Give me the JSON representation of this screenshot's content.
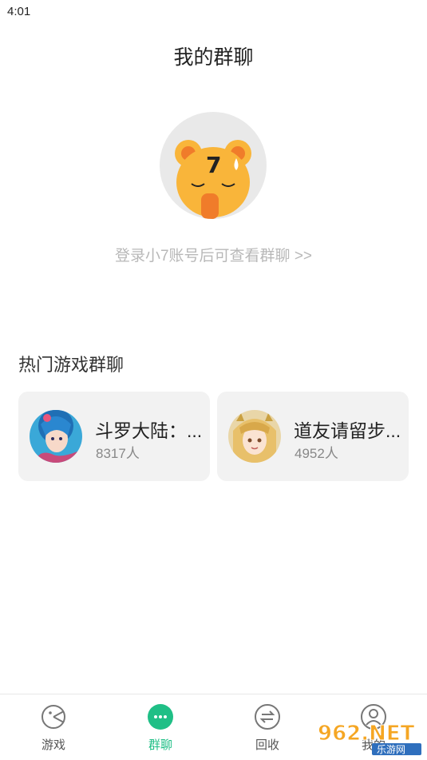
{
  "status_bar": {
    "time": "4:01"
  },
  "header": {
    "title": "我的群聊"
  },
  "login_prompt": {
    "text": "登录小7账号后可查看群聊 >>"
  },
  "hot_groups": {
    "title": "热门游戏群聊",
    "items": [
      {
        "name": "斗罗大陆：...",
        "count": "8317人"
      },
      {
        "name": "道友请留步...",
        "count": "4952人"
      }
    ]
  },
  "bottom_nav": {
    "active_color": "#1fbf86",
    "items": [
      {
        "label": "游戏",
        "icon": "gamepad-icon"
      },
      {
        "label": "群聊",
        "icon": "chat-icon",
        "active": true
      },
      {
        "label": "回收",
        "icon": "exchange-icon"
      },
      {
        "label": "我的",
        "icon": "user-icon"
      }
    ]
  },
  "watermark": {
    "text": "962.NET",
    "subtext": "乐游网"
  }
}
